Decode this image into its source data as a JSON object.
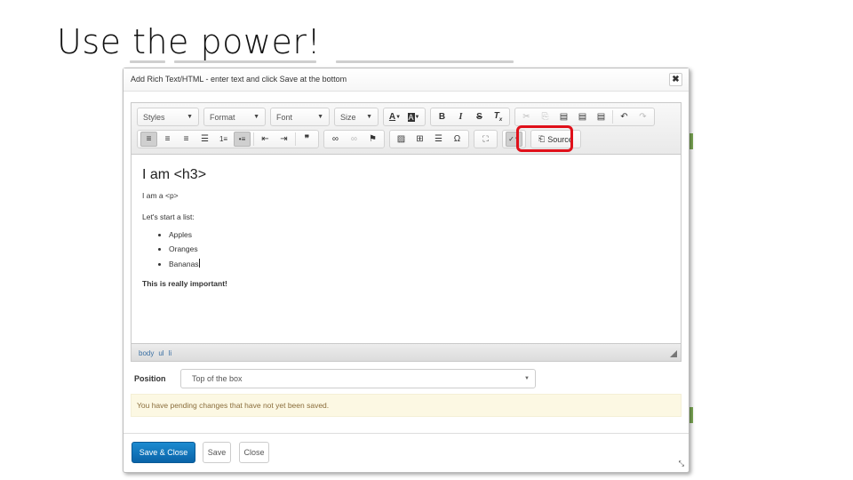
{
  "slide": {
    "title": "Use the power!"
  },
  "modal": {
    "title": "Add Rich Text/HTML - enter text and click Save at the bottom",
    "close_icon": "close-icon"
  },
  "toolbar": {
    "row1": {
      "combos": [
        {
          "label": "Styles"
        },
        {
          "label": "Format"
        },
        {
          "label": "Font"
        },
        {
          "label": "Size"
        }
      ],
      "color_buttons": [
        {
          "icon": "text-color-icon",
          "glyph": "A"
        },
        {
          "icon": "background-color-icon",
          "glyph": "A"
        }
      ],
      "format_buttons": [
        {
          "icon": "bold-icon",
          "glyph": "B"
        },
        {
          "icon": "italic-icon",
          "glyph": "I"
        },
        {
          "icon": "strikethrough-icon",
          "glyph": "S"
        },
        {
          "icon": "remove-format-icon",
          "glyph": "Tx"
        }
      ],
      "clipboard_buttons": [
        {
          "icon": "cut-icon",
          "glyph": "✂",
          "disabled": true
        },
        {
          "icon": "copy-icon",
          "glyph": "⎘",
          "disabled": true
        },
        {
          "icon": "paste-icon",
          "glyph": "📋"
        },
        {
          "icon": "paste-text-icon",
          "glyph": "📋"
        },
        {
          "icon": "paste-word-icon",
          "glyph": "📋"
        },
        {
          "icon": "undo-icon",
          "glyph": "↶"
        },
        {
          "icon": "redo-icon",
          "glyph": "↷",
          "disabled": true
        }
      ]
    },
    "row2": {
      "align_buttons": [
        {
          "icon": "align-left-icon",
          "glyph": "≡",
          "active": true
        },
        {
          "icon": "align-center-icon",
          "glyph": "≡"
        },
        {
          "icon": "align-right-icon",
          "glyph": "≡"
        },
        {
          "icon": "justify-icon",
          "glyph": "≡"
        },
        {
          "icon": "numbered-list-icon",
          "glyph": "⒈"
        },
        {
          "icon": "bulleted-list-icon",
          "glyph": "•≡",
          "active": true
        },
        {
          "icon": "decrease-indent-icon",
          "glyph": "⇤"
        },
        {
          "icon": "increase-indent-icon",
          "glyph": "⇥"
        },
        {
          "icon": "blockquote-icon",
          "glyph": "❞"
        }
      ],
      "link_buttons": [
        {
          "icon": "link-icon",
          "glyph": "∞"
        },
        {
          "icon": "unlink-icon",
          "glyph": "∞",
          "disabled": true
        },
        {
          "icon": "anchor-icon",
          "glyph": "⚑"
        }
      ],
      "insert_buttons": [
        {
          "icon": "image-icon",
          "glyph": "▨"
        },
        {
          "icon": "table-icon",
          "glyph": "⊞"
        },
        {
          "icon": "horizontal-line-icon",
          "glyph": "☰"
        },
        {
          "icon": "special-char-icon",
          "glyph": "Ω"
        }
      ],
      "maximize": {
        "icon": "maximize-icon",
        "glyph": "⛶"
      },
      "spellcheck": {
        "icon": "spellcheck-icon",
        "glyph": "ABC✓"
      },
      "source": {
        "icon": "source-icon",
        "glyph": "⎗",
        "label": "Source"
      }
    }
  },
  "content": {
    "heading": "I am <h3>",
    "paragraph": "I am a <p>",
    "list_intro": "Let's start a list:",
    "list_items": [
      "Apples",
      "Oranges",
      "Bananas"
    ],
    "important": "This is really important!"
  },
  "pathbar": {
    "items": [
      "body",
      "ul",
      "li"
    ]
  },
  "position": {
    "label": "Position",
    "selected": "Top of the box"
  },
  "warning": {
    "text": "You have pending changes that have not yet been saved."
  },
  "footer": {
    "save_close_label": "Save & Close",
    "save_label": "Save",
    "close_label": "Close"
  },
  "colors": {
    "primary_button": "#0a63a8",
    "highlight": "#e0101a",
    "warning_bg": "#fcf8e3",
    "warning_text": "#8a6d3b"
  }
}
